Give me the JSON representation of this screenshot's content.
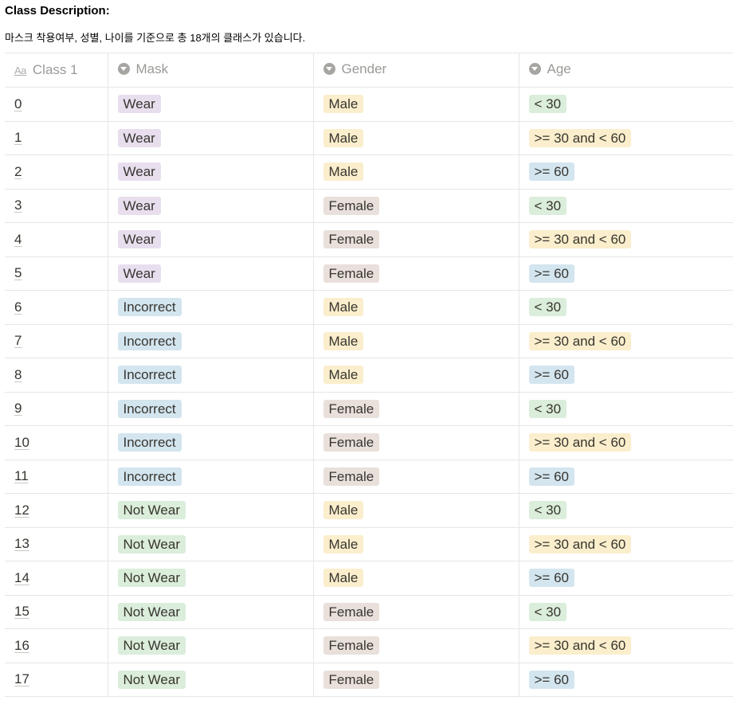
{
  "title": "Class Description:",
  "description": "마스크 착용여부, 성별, 나이를 기준으로 총 18개의 클래스가 있습니다.",
  "header_icons": [
    "text-property-icon",
    "select-property-icon"
  ],
  "tag_colors": {
    "purple": "#e8deee",
    "blue": "#d3e5ef",
    "green": "#dbeddb",
    "yellow": "#fbeecc",
    "brown": "#e9e5e3"
  },
  "table": {
    "headers": {
      "class": "Class 1",
      "mask": "Mask",
      "gender": "Gender",
      "age": "Age"
    },
    "rows": [
      {
        "id": "0",
        "mask": "Wear",
        "mask_color": "#e8deee",
        "gender": "Male",
        "gender_color": "#fbeecc",
        "age": "< 30",
        "age_color": "#dbeddb"
      },
      {
        "id": "1",
        "mask": "Wear",
        "mask_color": "#e8deee",
        "gender": "Male",
        "gender_color": "#fbeecc",
        "age": ">= 30 and < 60",
        "age_color": "#fbeecc"
      },
      {
        "id": "2",
        "mask": "Wear",
        "mask_color": "#e8deee",
        "gender": "Male",
        "gender_color": "#fbeecc",
        "age": ">= 60",
        "age_color": "#d3e5ef"
      },
      {
        "id": "3",
        "mask": "Wear",
        "mask_color": "#e8deee",
        "gender": "Female",
        "gender_color": "#e9e0db",
        "age": "< 30",
        "age_color": "#dbeddb"
      },
      {
        "id": "4",
        "mask": "Wear",
        "mask_color": "#e8deee",
        "gender": "Female",
        "gender_color": "#e9e0db",
        "age": ">= 30 and < 60",
        "age_color": "#fbeecc"
      },
      {
        "id": "5",
        "mask": "Wear",
        "mask_color": "#e8deee",
        "gender": "Female",
        "gender_color": "#e9e0db",
        "age": ">= 60",
        "age_color": "#d3e5ef"
      },
      {
        "id": "6",
        "mask": "Incorrect",
        "mask_color": "#d3e5ef",
        "gender": "Male",
        "gender_color": "#fbeecc",
        "age": "< 30",
        "age_color": "#dbeddb"
      },
      {
        "id": "7",
        "mask": "Incorrect",
        "mask_color": "#d3e5ef",
        "gender": "Male",
        "gender_color": "#fbeecc",
        "age": ">= 30 and < 60",
        "age_color": "#fbeecc"
      },
      {
        "id": "8",
        "mask": "Incorrect",
        "mask_color": "#d3e5ef",
        "gender": "Male",
        "gender_color": "#fbeecc",
        "age": ">= 60",
        "age_color": "#d3e5ef"
      },
      {
        "id": "9",
        "mask": "Incorrect",
        "mask_color": "#d3e5ef",
        "gender": "Female",
        "gender_color": "#e9e0db",
        "age": "< 30",
        "age_color": "#dbeddb"
      },
      {
        "id": "10",
        "mask": "Incorrect",
        "mask_color": "#d3e5ef",
        "gender": "Female",
        "gender_color": "#e9e0db",
        "age": ">= 30 and < 60",
        "age_color": "#fbeecc"
      },
      {
        "id": "11",
        "mask": "Incorrect",
        "mask_color": "#d3e5ef",
        "gender": "Female",
        "gender_color": "#e9e0db",
        "age": ">= 60",
        "age_color": "#d3e5ef"
      },
      {
        "id": "12",
        "mask": "Not Wear",
        "mask_color": "#dbeddb",
        "gender": "Male",
        "gender_color": "#fbeecc",
        "age": "< 30",
        "age_color": "#dbeddb"
      },
      {
        "id": "13",
        "mask": "Not Wear",
        "mask_color": "#dbeddb",
        "gender": "Male",
        "gender_color": "#fbeecc",
        "age": ">= 30 and < 60",
        "age_color": "#fbeecc"
      },
      {
        "id": "14",
        "mask": "Not Wear",
        "mask_color": "#dbeddb",
        "gender": "Male",
        "gender_color": "#fbeecc",
        "age": ">= 60",
        "age_color": "#d3e5ef"
      },
      {
        "id": "15",
        "mask": "Not Wear",
        "mask_color": "#dbeddb",
        "gender": "Female",
        "gender_color": "#e9e0db",
        "age": "< 30",
        "age_color": "#dbeddb"
      },
      {
        "id": "16",
        "mask": "Not Wear",
        "mask_color": "#dbeddb",
        "gender": "Female",
        "gender_color": "#e9e0db",
        "age": ">= 30 and < 60",
        "age_color": "#fbeecc"
      },
      {
        "id": "17",
        "mask": "Not Wear",
        "mask_color": "#dbeddb",
        "gender": "Female",
        "gender_color": "#e9e0db",
        "age": ">= 60",
        "age_color": "#d3e5ef"
      }
    ]
  }
}
